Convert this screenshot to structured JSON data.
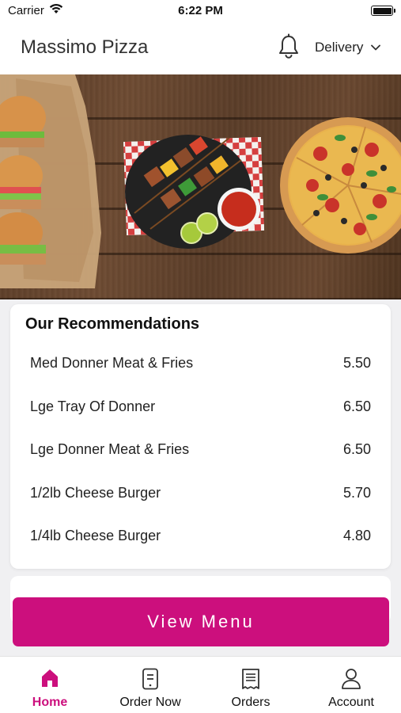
{
  "status_bar": {
    "carrier": "Carrier",
    "time": "6:22 PM"
  },
  "header": {
    "title": "Massimo Pizza",
    "delivery_label": "Delivery"
  },
  "recommendations": {
    "title": "Our Recommendations",
    "items": [
      {
        "name": "Med Donner Meat & Fries",
        "price": "5.50"
      },
      {
        "name": "Lge Tray Of Donner",
        "price": "6.50"
      },
      {
        "name": "Lge Donner Meat & Fries",
        "price": "6.50"
      },
      {
        "name": "1/2lb Cheese Burger",
        "price": "5.70"
      },
      {
        "name": "1/4lb Cheese Burger",
        "price": "4.80"
      }
    ]
  },
  "view_menu_label": "View Menu",
  "tabs": [
    {
      "label": "Home",
      "icon": "home-icon",
      "active": true
    },
    {
      "label": "Order Now",
      "icon": "phone-order-icon",
      "active": false
    },
    {
      "label": "Orders",
      "icon": "receipt-icon",
      "active": false
    },
    {
      "label": "Account",
      "icon": "person-icon",
      "active": false
    }
  ],
  "colors": {
    "accent": "#cc0f7d"
  }
}
